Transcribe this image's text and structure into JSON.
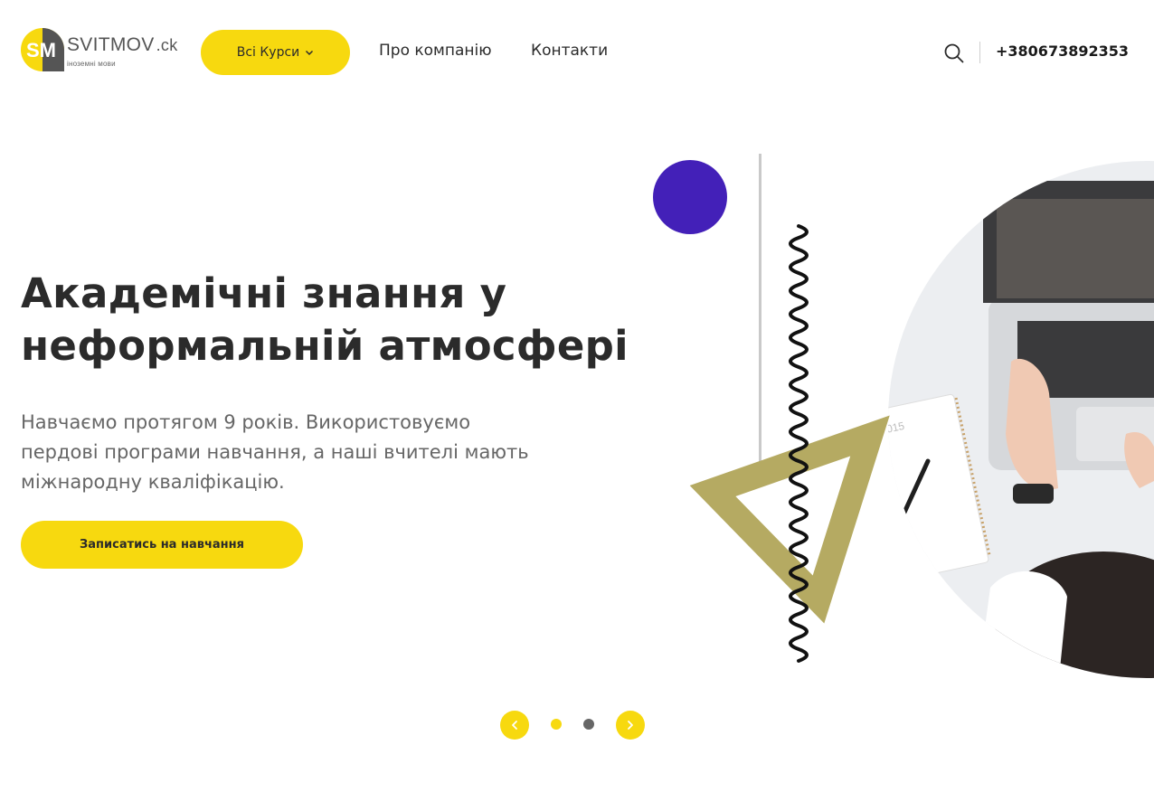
{
  "brand": {
    "name": "SVITMOV",
    "suffix": ".ck",
    "tagline": "іноземні мови",
    "logo_letters": "SM"
  },
  "nav": {
    "courses_label": "Всі Курси",
    "about_label": "Про компанію",
    "contacts_label": "Контакти"
  },
  "header": {
    "phone": "+380673892353"
  },
  "hero": {
    "title_line1": "Академічні знання у",
    "title_line2": "неформальній атмосфері",
    "desc_line1": "Навчаємо протягом 9 років. Використовуємо",
    "desc_line2": "пердові програми навчання, а наші вчителі мають",
    "desc_line3": "міжнародну кваліфікацію.",
    "cta_label": "Записатись на навчання",
    "photo_text": "ER 2015"
  },
  "slider": {
    "total_slides": 2,
    "active_slide": 1
  },
  "colors": {
    "accent": "#f7d90f",
    "circle": "#4320b8",
    "triangle": "#b5aa62",
    "text": "#2b2b2b",
    "muted": "#666666"
  },
  "icons": {
    "search": "search-icon",
    "courses_dropdown": "chevron-down-icon",
    "prev": "chevron-left-icon",
    "next": "chevron-right-icon"
  }
}
